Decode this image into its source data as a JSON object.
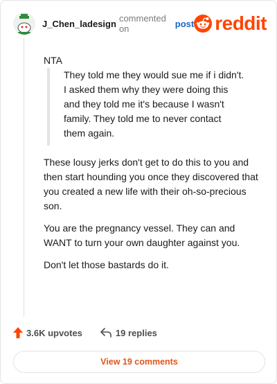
{
  "header": {
    "username": "J_Chen_ladesign",
    "commented_on": "commented on",
    "post_link": "post",
    "logo_text": "reddit"
  },
  "comment": {
    "line1": "NTA",
    "quote": [
      "They told me they would sue me if i didn't.",
      "I asked them why they were doing this",
      "and they told me it's because I wasn't",
      "family. They told me to never contact",
      "them again."
    ],
    "paragraphs": [
      "These lousy jerks don't get to do this to you and then start hounding you once they discovered that you created a new life with their oh-so-precious son.",
      "You are the pregnancy vessel. They can and WANT to turn your own daughter against you.",
      "Don't let those bastards do it."
    ]
  },
  "footer": {
    "upvotes": "3.6K upvotes",
    "replies": "19 replies"
  },
  "view_button": "View 19 comments",
  "colors": {
    "brand": "#ff4500",
    "link": "#1c66c6",
    "view_button_text": "#e0561c"
  }
}
